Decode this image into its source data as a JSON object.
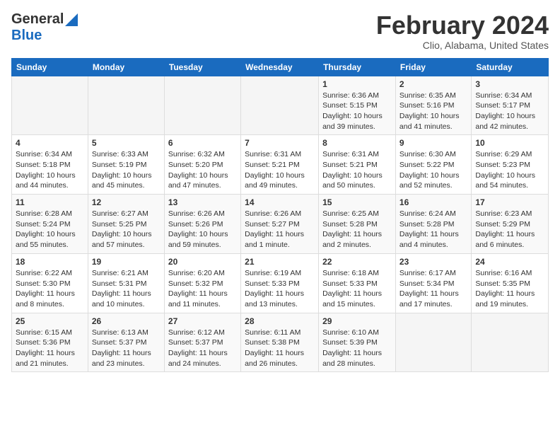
{
  "header": {
    "logo_general": "General",
    "logo_blue": "Blue",
    "title": "February 2024",
    "subtitle": "Clio, Alabama, United States"
  },
  "weekdays": [
    "Sunday",
    "Monday",
    "Tuesday",
    "Wednesday",
    "Thursday",
    "Friday",
    "Saturday"
  ],
  "weeks": [
    [
      {
        "day": "",
        "detail": ""
      },
      {
        "day": "",
        "detail": ""
      },
      {
        "day": "",
        "detail": ""
      },
      {
        "day": "",
        "detail": ""
      },
      {
        "day": "1",
        "detail": "Sunrise: 6:36 AM\nSunset: 5:15 PM\nDaylight: 10 hours\nand 39 minutes."
      },
      {
        "day": "2",
        "detail": "Sunrise: 6:35 AM\nSunset: 5:16 PM\nDaylight: 10 hours\nand 41 minutes."
      },
      {
        "day": "3",
        "detail": "Sunrise: 6:34 AM\nSunset: 5:17 PM\nDaylight: 10 hours\nand 42 minutes."
      }
    ],
    [
      {
        "day": "4",
        "detail": "Sunrise: 6:34 AM\nSunset: 5:18 PM\nDaylight: 10 hours\nand 44 minutes."
      },
      {
        "day": "5",
        "detail": "Sunrise: 6:33 AM\nSunset: 5:19 PM\nDaylight: 10 hours\nand 45 minutes."
      },
      {
        "day": "6",
        "detail": "Sunrise: 6:32 AM\nSunset: 5:20 PM\nDaylight: 10 hours\nand 47 minutes."
      },
      {
        "day": "7",
        "detail": "Sunrise: 6:31 AM\nSunset: 5:21 PM\nDaylight: 10 hours\nand 49 minutes."
      },
      {
        "day": "8",
        "detail": "Sunrise: 6:31 AM\nSunset: 5:21 PM\nDaylight: 10 hours\nand 50 minutes."
      },
      {
        "day": "9",
        "detail": "Sunrise: 6:30 AM\nSunset: 5:22 PM\nDaylight: 10 hours\nand 52 minutes."
      },
      {
        "day": "10",
        "detail": "Sunrise: 6:29 AM\nSunset: 5:23 PM\nDaylight: 10 hours\nand 54 minutes."
      }
    ],
    [
      {
        "day": "11",
        "detail": "Sunrise: 6:28 AM\nSunset: 5:24 PM\nDaylight: 10 hours\nand 55 minutes."
      },
      {
        "day": "12",
        "detail": "Sunrise: 6:27 AM\nSunset: 5:25 PM\nDaylight: 10 hours\nand 57 minutes."
      },
      {
        "day": "13",
        "detail": "Sunrise: 6:26 AM\nSunset: 5:26 PM\nDaylight: 10 hours\nand 59 minutes."
      },
      {
        "day": "14",
        "detail": "Sunrise: 6:26 AM\nSunset: 5:27 PM\nDaylight: 11 hours\nand 1 minute."
      },
      {
        "day": "15",
        "detail": "Sunrise: 6:25 AM\nSunset: 5:28 PM\nDaylight: 11 hours\nand 2 minutes."
      },
      {
        "day": "16",
        "detail": "Sunrise: 6:24 AM\nSunset: 5:28 PM\nDaylight: 11 hours\nand 4 minutes."
      },
      {
        "day": "17",
        "detail": "Sunrise: 6:23 AM\nSunset: 5:29 PM\nDaylight: 11 hours\nand 6 minutes."
      }
    ],
    [
      {
        "day": "18",
        "detail": "Sunrise: 6:22 AM\nSunset: 5:30 PM\nDaylight: 11 hours\nand 8 minutes."
      },
      {
        "day": "19",
        "detail": "Sunrise: 6:21 AM\nSunset: 5:31 PM\nDaylight: 11 hours\nand 10 minutes."
      },
      {
        "day": "20",
        "detail": "Sunrise: 6:20 AM\nSunset: 5:32 PM\nDaylight: 11 hours\nand 11 minutes."
      },
      {
        "day": "21",
        "detail": "Sunrise: 6:19 AM\nSunset: 5:33 PM\nDaylight: 11 hours\nand 13 minutes."
      },
      {
        "day": "22",
        "detail": "Sunrise: 6:18 AM\nSunset: 5:33 PM\nDaylight: 11 hours\nand 15 minutes."
      },
      {
        "day": "23",
        "detail": "Sunrise: 6:17 AM\nSunset: 5:34 PM\nDaylight: 11 hours\nand 17 minutes."
      },
      {
        "day": "24",
        "detail": "Sunrise: 6:16 AM\nSunset: 5:35 PM\nDaylight: 11 hours\nand 19 minutes."
      }
    ],
    [
      {
        "day": "25",
        "detail": "Sunrise: 6:15 AM\nSunset: 5:36 PM\nDaylight: 11 hours\nand 21 minutes."
      },
      {
        "day": "26",
        "detail": "Sunrise: 6:13 AM\nSunset: 5:37 PM\nDaylight: 11 hours\nand 23 minutes."
      },
      {
        "day": "27",
        "detail": "Sunrise: 6:12 AM\nSunset: 5:37 PM\nDaylight: 11 hours\nand 24 minutes."
      },
      {
        "day": "28",
        "detail": "Sunrise: 6:11 AM\nSunset: 5:38 PM\nDaylight: 11 hours\nand 26 minutes."
      },
      {
        "day": "29",
        "detail": "Sunrise: 6:10 AM\nSunset: 5:39 PM\nDaylight: 11 hours\nand 28 minutes."
      },
      {
        "day": "",
        "detail": ""
      },
      {
        "day": "",
        "detail": ""
      }
    ]
  ]
}
